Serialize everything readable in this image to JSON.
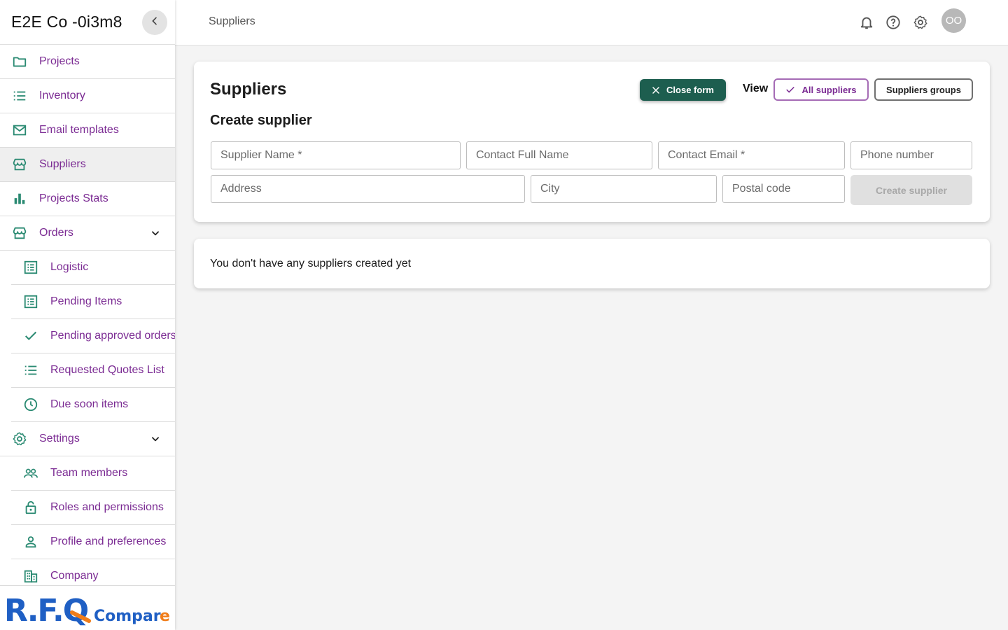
{
  "sidebar": {
    "company_name": "E2E Co -0i3m8",
    "items": [
      {
        "label": "Projects"
      },
      {
        "label": "Inventory"
      },
      {
        "label": "Email templates"
      },
      {
        "label": "Suppliers"
      },
      {
        "label": "Projects Stats"
      },
      {
        "label": "Orders"
      },
      {
        "label": "Logistic"
      },
      {
        "label": "Pending Items"
      },
      {
        "label": "Pending approved orders"
      },
      {
        "label": "Requested Quotes List"
      },
      {
        "label": "Due soon items"
      },
      {
        "label": "Settings"
      },
      {
        "label": "Team members"
      },
      {
        "label": "Roles and permissions"
      },
      {
        "label": "Profile and preferences"
      },
      {
        "label": "Company"
      }
    ],
    "logo": "R.F.Q Compare",
    "logo_colors": {
      "blue": "#1f5fc4",
      "orange": "#f07d1a"
    }
  },
  "topbar": {
    "breadcrumb": "Suppliers",
    "avatar_initials": "OO"
  },
  "main": {
    "title": "Suppliers",
    "close_form_label": "Close form",
    "view_label": "View",
    "view_options": [
      "All suppliers",
      "Suppliers groups"
    ],
    "selected_view": "All suppliers",
    "form_title": "Create supplier",
    "fields": {
      "supplier_name": "Supplier Name *",
      "contact_full_name": "Contact Full Name",
      "contact_email": "Contact Email *",
      "phone_number": "Phone number",
      "address": "Address",
      "city": "City",
      "postal_code": "Postal code"
    },
    "create_button_label": "Create supplier",
    "empty_message": "You don't have any suppliers created yet"
  },
  "colors": {
    "accent_green": "#1d5e4f",
    "icon_teal": "#2a8a72",
    "link_purple": "#7b2b93"
  }
}
